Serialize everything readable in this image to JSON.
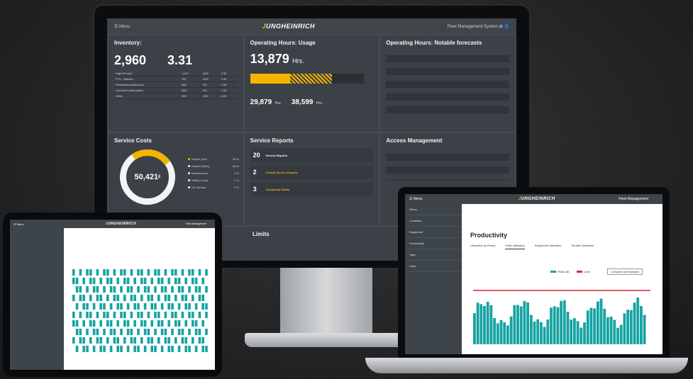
{
  "monitor": {
    "menu_label": "Menu",
    "brand": "JUNGHEINRICH",
    "fleet_label": "Fleet Management System",
    "inventory": {
      "title": "Inventory:",
      "kpi1": "2,960",
      "kpi2": "3.31",
      "rows": [
        [
          "High lift truck",
          "1,047",
          "34%",
          "3.26"
        ],
        [
          "FTH - Stacker",
          "705",
          "18%",
          "3.45"
        ],
        [
          "Pedestrian pallet truck",
          "285",
          "9%",
          "3.05"
        ],
        [
          "Low level order picker",
          "265",
          "8%",
          "7.05"
        ],
        [
          "Other",
          "325",
          "12%",
          "6.25"
        ]
      ]
    },
    "usage": {
      "title": "Operating Hours: Usage",
      "value": "13,879",
      "unit": "Hrs.",
      "progress": 0.35,
      "forecast": 0.37,
      "stat1": "29,879",
      "stat1_unit": "Hrs.",
      "stat2": "38,599",
      "stat2_unit": "Hrs."
    },
    "forecasts": {
      "title": "Operating Hours: Notable forecasts"
    },
    "service_costs": {
      "title": "Service Costs",
      "total": "50,421",
      "currency": "€",
      "legend": [
        {
          "label": "Repair (Cus...",
          "value": "16 %",
          "color": "#f5b400"
        },
        {
          "label": "Repair (Other)",
          "value": "66 %",
          "color": "#f2f4f5"
        },
        {
          "label": "Maintenance",
          "value": "4 %",
          "color": "#f2f4f5"
        },
        {
          "label": "Safety Check",
          "value": "7 %",
          "color": "#f2f4f5"
        },
        {
          "label": "UV Service",
          "value": "3 %",
          "color": "#f2f4f5"
        }
      ]
    },
    "service_reports": {
      "title": "Service Reports",
      "items": [
        {
          "count": "20",
          "label": "Service Reports"
        },
        {
          "count": "2",
          "label": "Critical Service Reports"
        },
        {
          "count": "3",
          "label": "Completed Faults"
        }
      ]
    },
    "access": {
      "title": "Access Management"
    },
    "limits": {
      "title": "Limits"
    }
  },
  "tablet": {
    "menu_label": "Menu",
    "brand": "JUNGHEINRICH",
    "fleet_label": "Fleet Management"
  },
  "laptop": {
    "menu_label": "Menu",
    "brand": "JUNGHEINRICH",
    "fleet_label": "Fleet Management",
    "page_title": "Productivity",
    "sidebar": [
      "Filters",
      "Locations",
      "Equipment",
      "Productivity",
      "Tags",
      "Links"
    ],
    "tabs": [
      "Utilization by Period",
      "Peak Utilization",
      "Equipment Utilization",
      "Parallel Utilization"
    ],
    "legend_peak": "Peak Util.",
    "legend_limit": "Limit",
    "dropdown": "Compare and Analysis"
  }
}
